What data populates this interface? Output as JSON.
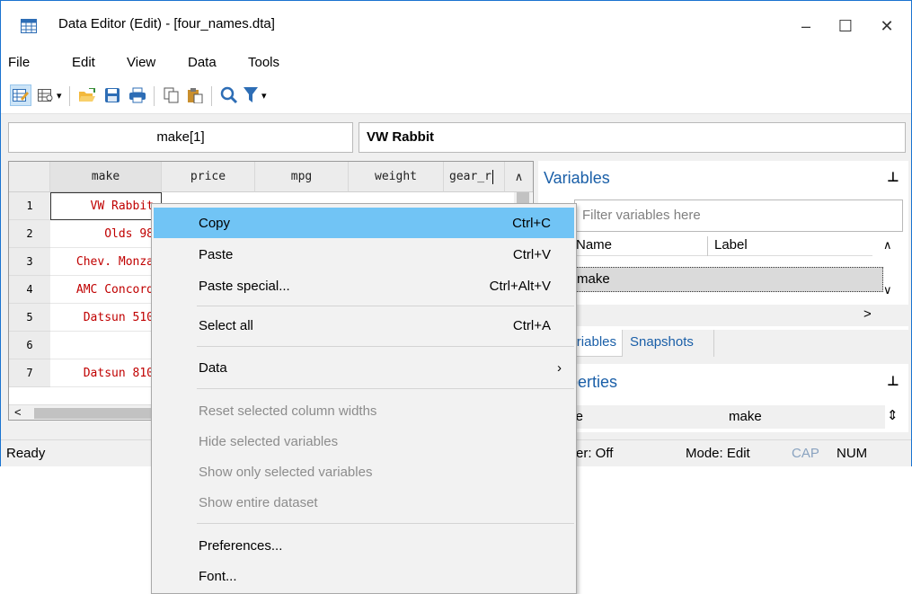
{
  "window": {
    "title": "Data Editor (Edit) - [four_names.dta]",
    "controls": {
      "minimize": "–",
      "maximize": "☐",
      "close": "✕"
    }
  },
  "menubar": {
    "items": [
      "File",
      "Edit",
      "View",
      "Data",
      "Tools"
    ]
  },
  "toolbar": {
    "buttons": [
      "edit-mode-icon",
      "browse-mode-icon",
      "open-icon",
      "save-icon",
      "print-icon",
      "copy-icon",
      "paste-icon",
      "find-icon",
      "filter-icon"
    ],
    "dropdown_arrow": "▾"
  },
  "cellbar": {
    "name": "make[1]",
    "value": "VW Rabbit"
  },
  "grid": {
    "columns": [
      "make",
      "price",
      "mpg",
      "weight",
      "gear_r"
    ],
    "rows": [
      {
        "num": "1",
        "make": "VW Rabbit"
      },
      {
        "num": "2",
        "make": "Olds 98"
      },
      {
        "num": "3",
        "make": "Chev. Monza"
      },
      {
        "num": "4",
        "make": "AMC Concord"
      },
      {
        "num": "5",
        "make": "Datsun 510"
      },
      {
        "num": "6",
        "make": ""
      },
      {
        "num": "7",
        "make": "Datsun 810"
      }
    ],
    "scroll_up": "∧",
    "scroll_left": "<"
  },
  "variables_panel": {
    "title": "Variables",
    "filter_placeholder": "Filter variables here",
    "headers": {
      "name": "Name",
      "label": "Label"
    },
    "items": [
      "make"
    ],
    "pin": "⊥",
    "scroll_up": "∧",
    "scroll_down": "∨",
    "scroll_right": ">"
  },
  "tabs": [
    "Variables",
    "Snapshots"
  ],
  "properties_panel": {
    "title": "Properties",
    "row_label": "Name",
    "row_value": "make",
    "pin": "⊥",
    "spin": "⇕"
  },
  "statusbar": {
    "ready": "Ready",
    "filter": "Filter: Off",
    "mode": "Mode: Edit",
    "cap": "CAP",
    "num": "NUM"
  },
  "context_menu": {
    "items": [
      {
        "label": "Copy",
        "shortcut": "Ctrl+C",
        "highlighted": true
      },
      {
        "label": "Paste",
        "shortcut": "Ctrl+V"
      },
      {
        "label": "Paste special...",
        "shortcut": "Ctrl+Alt+V"
      },
      {
        "label": "Select all",
        "shortcut": "Ctrl+A"
      },
      {
        "label": "Data",
        "shortcut": "›"
      },
      {
        "label": "Reset selected column widths",
        "disabled": true
      },
      {
        "label": "Hide selected variables",
        "disabled": true
      },
      {
        "label": "Show only selected variables",
        "disabled": true
      },
      {
        "label": "Show entire dataset",
        "disabled": true
      },
      {
        "label": "Preferences..."
      },
      {
        "label": "Font..."
      }
    ]
  },
  "colors": {
    "accent": "#1a73d0",
    "highlight": "#71c4f5",
    "string_value": "#c00000",
    "panel_title": "#1a5fa8"
  }
}
